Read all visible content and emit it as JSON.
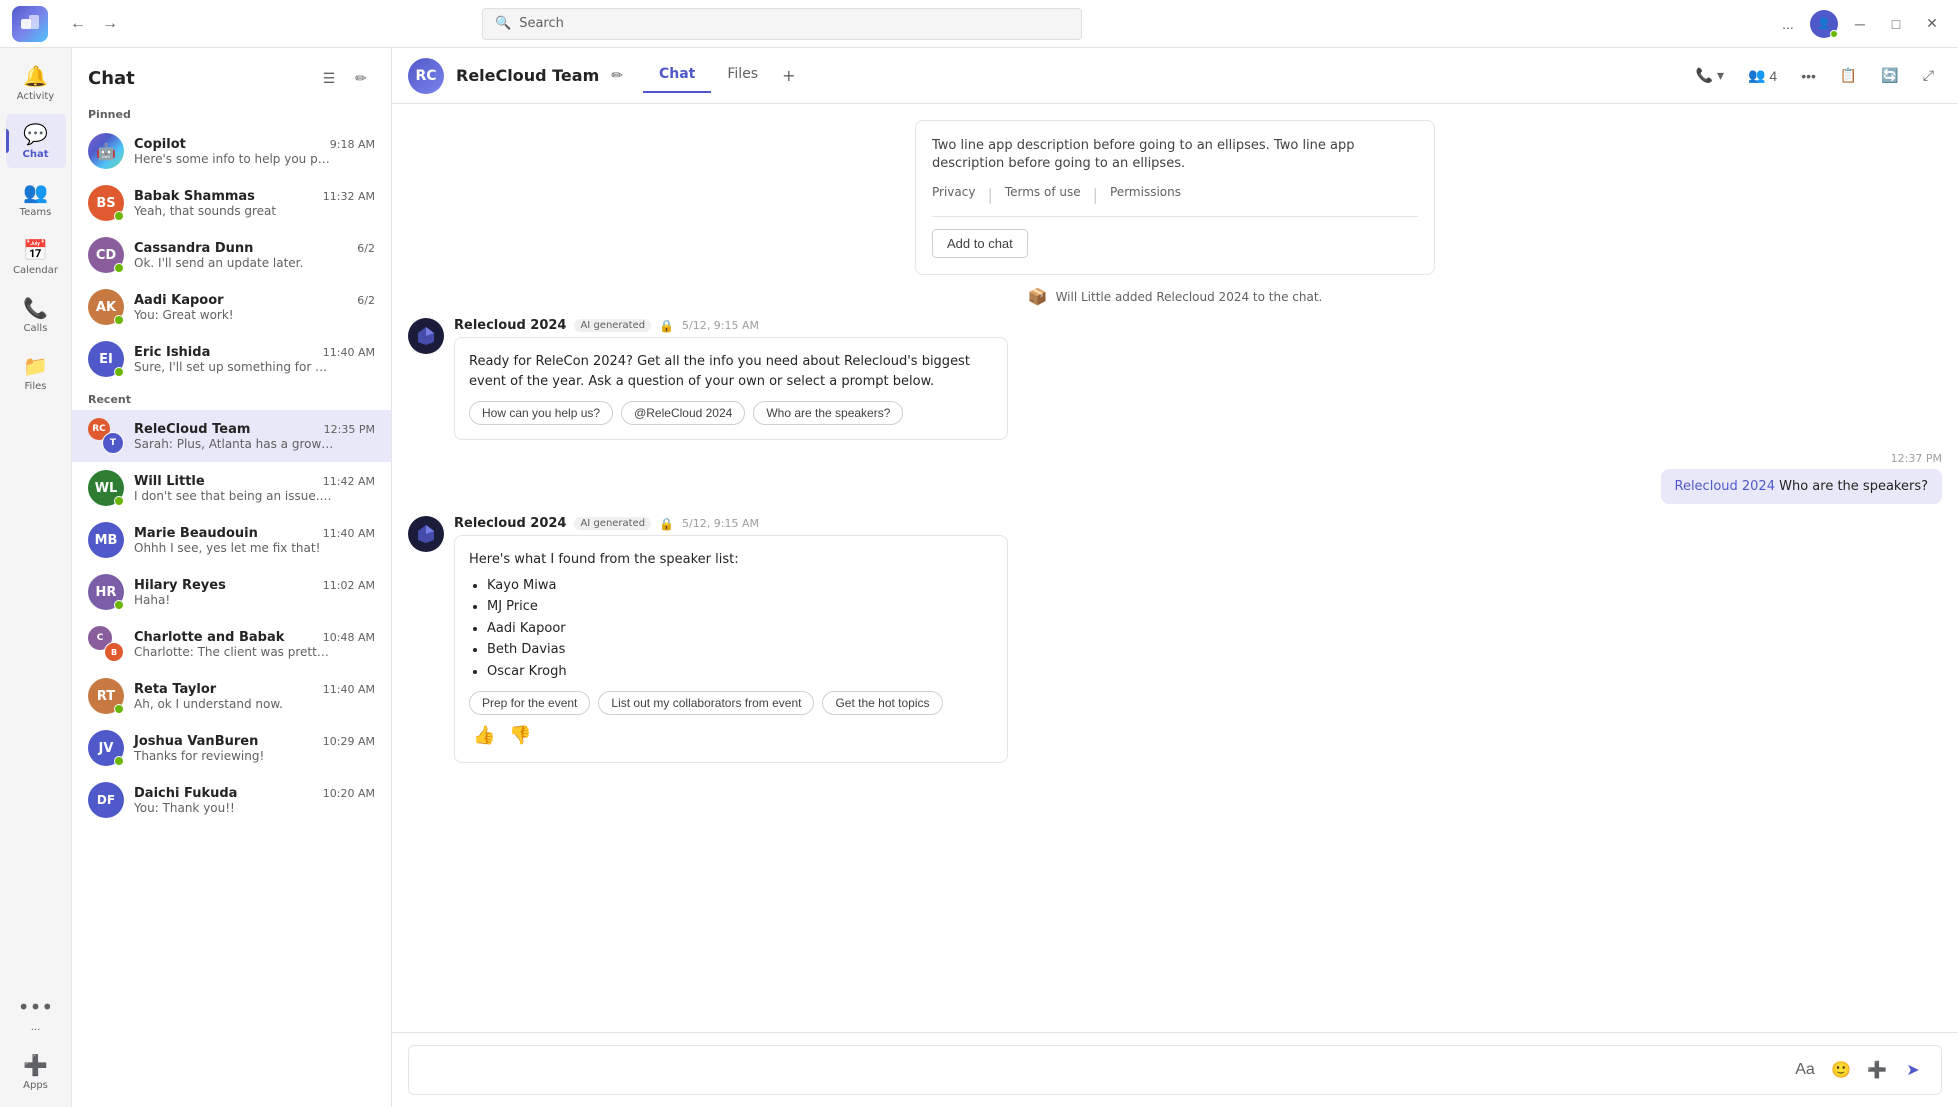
{
  "titlebar": {
    "logo": "T",
    "search_placeholder": "Search",
    "more_label": "...",
    "minimize_label": "─",
    "maximize_label": "□",
    "close_label": "✕"
  },
  "sidebar": {
    "items": [
      {
        "id": "activity",
        "icon": "🔔",
        "label": "Activity"
      },
      {
        "id": "chat",
        "icon": "💬",
        "label": "Chat"
      },
      {
        "id": "teams",
        "icon": "👥",
        "label": "Teams"
      },
      {
        "id": "calendar",
        "icon": "📅",
        "label": "Calendar"
      },
      {
        "id": "calls",
        "icon": "📞",
        "label": "Calls"
      },
      {
        "id": "files",
        "icon": "📁",
        "label": "Files"
      }
    ],
    "more_label": "...",
    "apps_label": "Apps"
  },
  "chat_list": {
    "title": "Chat",
    "pinned_label": "Pinned",
    "recent_label": "Recent",
    "items_pinned": [
      {
        "id": "copilot",
        "name": "Copilot",
        "time": "9:18 AM",
        "preview": "Here's some info to help you prep for your...",
        "avatar_color": "gradient",
        "avatar_text": "C",
        "status": "none"
      },
      {
        "id": "babak",
        "name": "Babak Shammas",
        "time": "11:32 AM",
        "preview": "Yeah, that sounds great",
        "avatar_color": "#e05a30",
        "avatar_text": "BS",
        "status": "online"
      },
      {
        "id": "cassandra",
        "name": "Cassandra Dunn",
        "time": "6/2",
        "preview": "Ok. I'll send an update later.",
        "avatar_color": "#8a5e9c",
        "avatar_text": "CD",
        "status": "online"
      },
      {
        "id": "aadi",
        "name": "Aadi Kapoor",
        "time": "6/2",
        "preview": "You: Great work!",
        "avatar_color": "#c87941",
        "avatar_text": "AK",
        "status": "online"
      },
      {
        "id": "eric",
        "name": "Eric Ishida",
        "time": "11:40 AM",
        "preview": "Sure, I'll set up something for next week t...",
        "avatar_color": "#5059C9",
        "avatar_text": "EI",
        "status": "online"
      }
    ],
    "items_recent": [
      {
        "id": "relecloudteam",
        "name": "ReleCloud Team",
        "time": "12:35 PM",
        "preview": "Sarah: Plus, Atlanta has a growing tech ...",
        "avatar_type": "multi",
        "status": "none",
        "active": true
      },
      {
        "id": "willlittle",
        "name": "Will Little",
        "time": "11:42 AM",
        "preview": "I don't see that being an issue. Can you ta...",
        "avatar_color": "#2e7d32",
        "avatar_text": "WL",
        "status": "online"
      },
      {
        "id": "marie",
        "name": "Marie Beaudouin",
        "time": "11:40 AM",
        "preview": "Ohhh I see, yes let me fix that!",
        "avatar_color": "#5059C9",
        "avatar_text": "MB",
        "status": "none",
        "avatar_initials": true
      },
      {
        "id": "hilary",
        "name": "Hilary Reyes",
        "time": "11:02 AM",
        "preview": "Haha!",
        "avatar_color": "#7b5ea7",
        "avatar_text": "HR",
        "status": "online"
      },
      {
        "id": "charlottebabak",
        "name": "Charlotte and Babak",
        "time": "10:48 AM",
        "preview": "Charlotte: The client was pretty happy with...",
        "avatar_type": "group",
        "status": "none"
      },
      {
        "id": "reta",
        "name": "Reta Taylor",
        "time": "11:40 AM",
        "preview": "Ah, ok I understand now.",
        "avatar_color": "#c87941",
        "avatar_text": "RT",
        "status": "online"
      },
      {
        "id": "joshua",
        "name": "Joshua VanBuren",
        "time": "10:29 AM",
        "preview": "Thanks for reviewing!",
        "avatar_color": "#5059C9",
        "avatar_text": "JV",
        "status": "online"
      },
      {
        "id": "daichi",
        "name": "Daichi Fukuda",
        "time": "10:20 AM",
        "preview": "You: Thank you!!",
        "avatar_initials": "DF",
        "avatar_color": "#5059C9",
        "status": "none"
      }
    ]
  },
  "chat_main": {
    "title": "ReleCloud Team",
    "tab_chat": "Chat",
    "tab_files": "Files",
    "tab_add": "+",
    "edit_icon": "✏",
    "participants_count": "4",
    "header_actions": {
      "call": "📞",
      "more": "...",
      "expand": "⊞",
      "settings": "⚙",
      "popout": "⤢"
    }
  },
  "messages": {
    "app_card": {
      "description": "Two line app description before going to an ellipses. Two line app description before going to an ellipses.",
      "link_privacy": "Privacy",
      "link_terms": "Terms of use",
      "link_permissions": "Permissions",
      "btn_add": "Add to chat"
    },
    "system": {
      "icon": "📦",
      "text": "Will Little added Relecloud 2024 to the chat."
    },
    "bot_message_1": {
      "sender": "Relecloud 2024",
      "badge": "AI generated",
      "time": "5/12, 9:15 AM",
      "content": "Ready for ReleCon 2024? Get all the info you need about Relecloud's biggest event of the year. Ask a question of your own or select a prompt below.",
      "chips": [
        "How can you help us?",
        "@ReleCloud 2024",
        "Who are the speakers?"
      ]
    },
    "user_message": {
      "time": "12:37 PM",
      "mention": "Relecloud 2024",
      "text": "Who are the speakers?"
    },
    "bot_message_2": {
      "sender": "Relecloud 2024",
      "badge": "AI generated",
      "time": "5/12, 9:15 AM",
      "intro": "Here's what I found from the speaker list:",
      "speakers": [
        "Kayo Miwa",
        "MJ Price",
        "Aadi Kapoor",
        "Beth Davias",
        "Oscar Krogh"
      ],
      "chips": [
        "Prep for the event",
        "List out my collaborators from event",
        "Get the hot topics"
      ]
    }
  },
  "compose": {
    "placeholder": ""
  }
}
